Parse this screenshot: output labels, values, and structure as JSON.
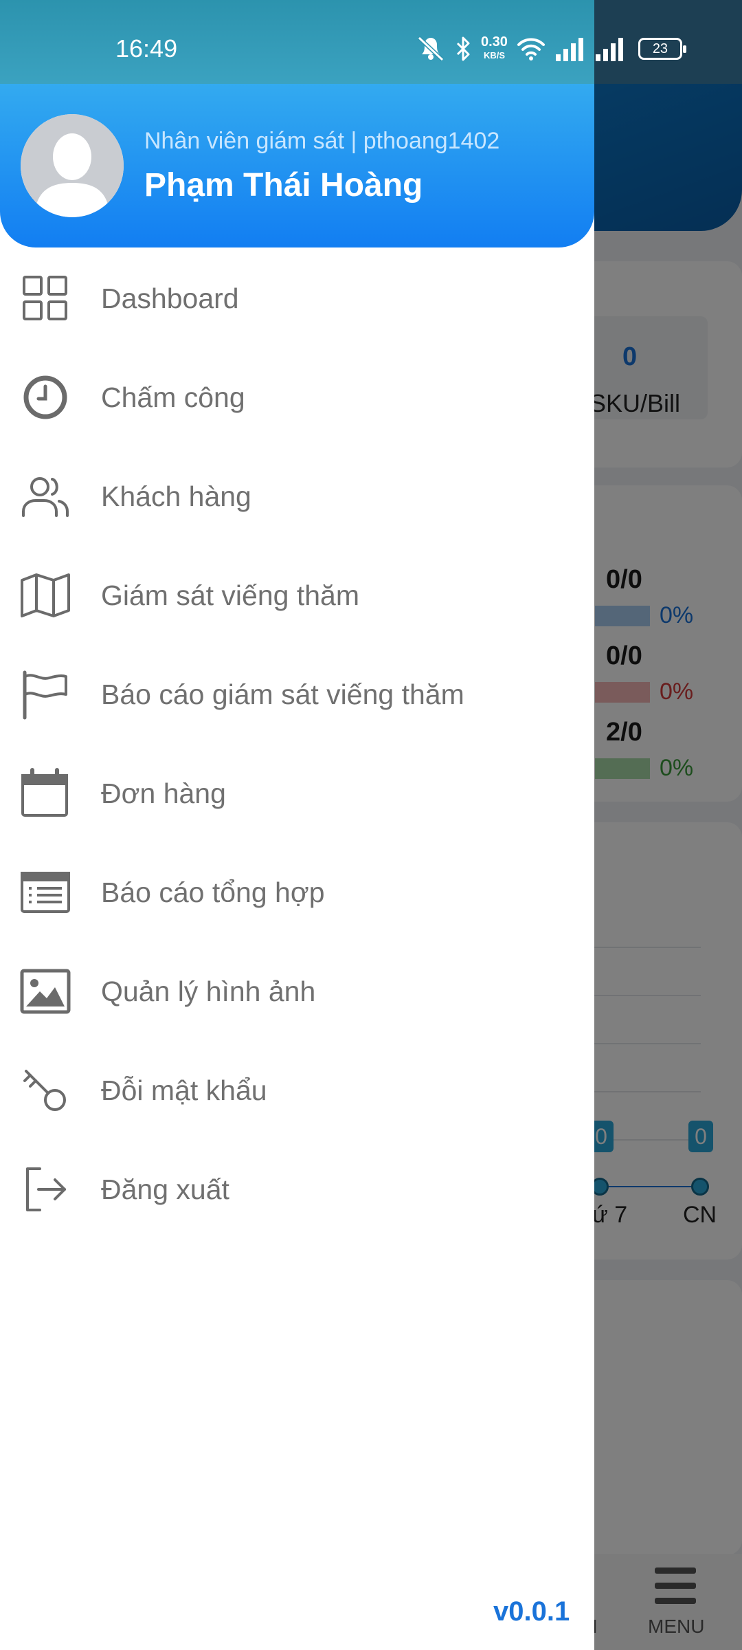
{
  "status_bar": {
    "time": "16:49",
    "speed_value": "0.30",
    "speed_unit": "KB/S",
    "battery": "23",
    "icons": [
      "bell-off-icon",
      "bluetooth-icon",
      "wifi-icon",
      "signal-icon",
      "signal-icon",
      "battery-icon"
    ]
  },
  "drawer": {
    "role_line": "Nhân viên giám sát | pthoang1402",
    "user_name": "Phạm Thái Hoàng",
    "menu": [
      {
        "label": "Dashboard",
        "icon": "dashboard-grid-icon"
      },
      {
        "label": "Chấm công",
        "icon": "clock-icon"
      },
      {
        "label": "Khách hàng",
        "icon": "users-icon"
      },
      {
        "label": "Giám sát viếng thăm",
        "icon": "map-icon"
      },
      {
        "label": "Báo cáo giám sát viếng thăm",
        "icon": "flag-icon"
      },
      {
        "label": "Đơn hàng",
        "icon": "calendar-icon"
      },
      {
        "label": "Báo cáo tổng hợp",
        "icon": "list-report-icon"
      },
      {
        "label": "Quản lý hình ảnh",
        "icon": "image-icon"
      },
      {
        "label": "Đỗi mật khẩu",
        "icon": "key-icon"
      },
      {
        "label": "Đăng xuất",
        "icon": "logout-icon"
      }
    ],
    "version": "v0.0.1",
    "accent_color": "#1a73d9",
    "header_gradient": [
      "#33aaf0",
      "#127ef2"
    ]
  },
  "background": {
    "sku_value": "0",
    "sku_label": "SKU/Bill",
    "ratios": [
      {
        "value": "0/0",
        "percent": "0%",
        "color": "#1a73d9",
        "bar_color": "#a9cdf0"
      },
      {
        "value": "0/0",
        "percent": "0%",
        "color": "#d33b3b",
        "bar_color": "#f5b7b7"
      },
      {
        "value": "2/0",
        "percent": "0%",
        "color": "#3a9b3a",
        "bar_color": "#a9dba9"
      }
    ],
    "timeline": {
      "badges": [
        "0",
        "0"
      ],
      "days": [
        "ứ 7",
        "CN"
      ]
    },
    "bottom_nav": {
      "menu_label": "MENU",
      "prev_label": "I"
    }
  }
}
